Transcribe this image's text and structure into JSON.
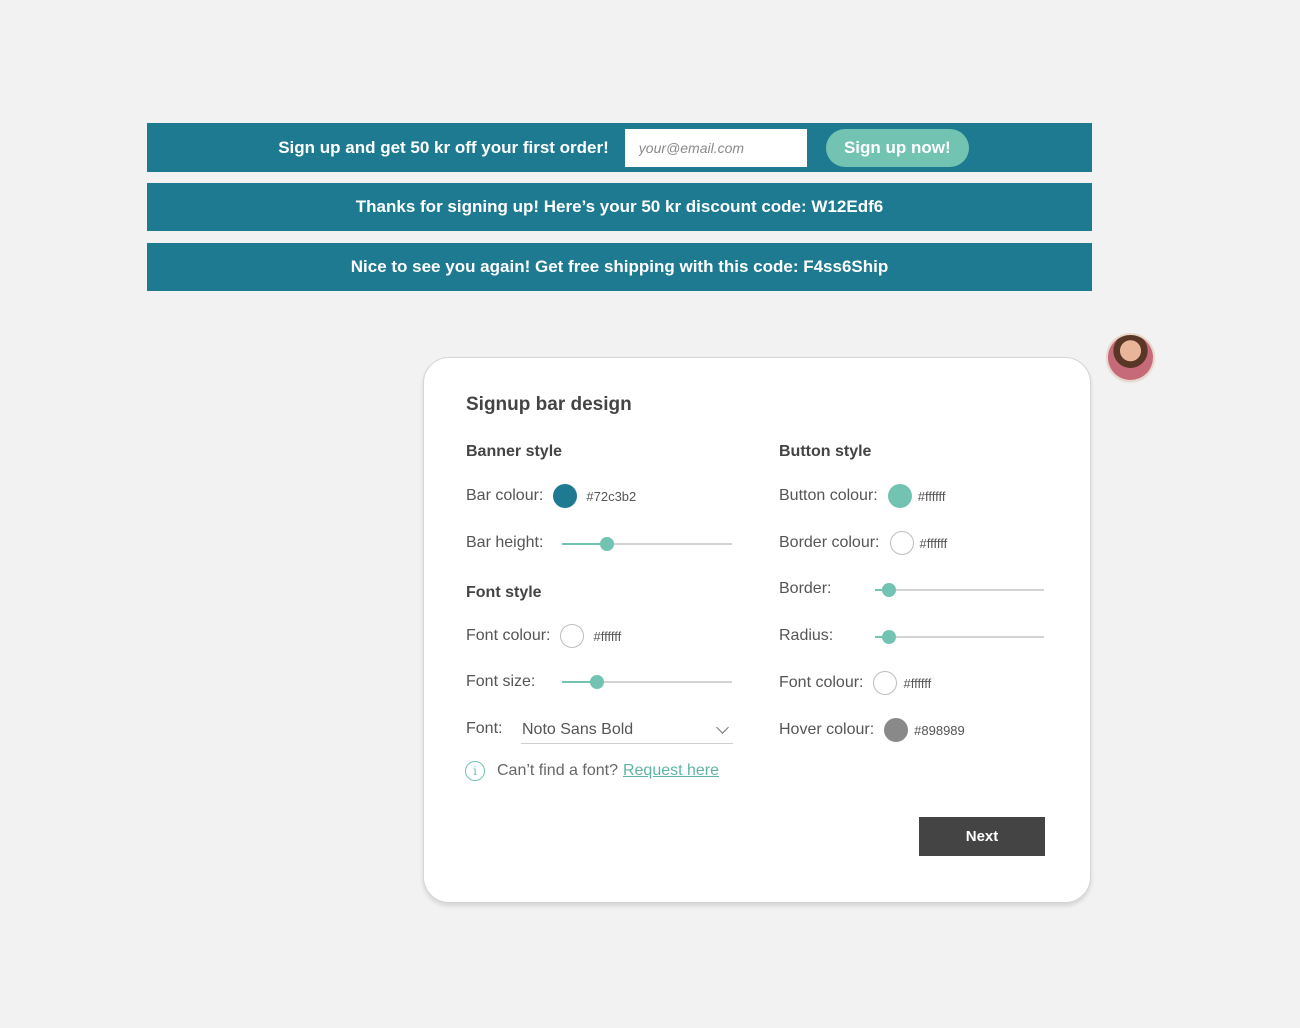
{
  "banners": {
    "signup": {
      "text": "Sign up and get 50 kr off your first order!",
      "email_placeholder": "your@email.com",
      "button_label": "Sign up now!"
    },
    "thanks": {
      "text": "Thanks for signing up! Here’s your 50 kr discount code: W12Edf6"
    },
    "returning": {
      "text": "Nice to see you again! Get free shipping with this code: F4ss6Ship"
    }
  },
  "card": {
    "title": "Signup bar design",
    "banner_style": {
      "title": "Banner style",
      "bar_colour_label": "Bar colour:",
      "bar_colour_value": "#72c3b2",
      "bar_colour_swatch": "#1d7a91",
      "bar_height_label": "Bar height:",
      "bar_height_level": 0.22
    },
    "font_style": {
      "title": "Font style",
      "font_colour_label": "Font colour:",
      "font_colour_value": "#ffffff",
      "font_size_label": "Font size:",
      "font_size_level": 0.15,
      "font_label": "Font:",
      "font_value": "Noto Sans Bold",
      "help_text": "Can’t find a font?",
      "help_link": "Request here"
    },
    "button_style": {
      "title": "Button style",
      "button_colour_label": "Button colour:",
      "button_colour_value": "#ffffff",
      "button_colour_swatch": "#72c3b2",
      "border_colour_label": "Border colour:",
      "border_colour_value": "#ffffff",
      "border_label": "Border:",
      "border_level": 0.0,
      "radius_label": "Radius:",
      "radius_level": 0.0,
      "font_colour_label": "Font colour:",
      "font_colour_value": "#ffffff",
      "hover_colour_label": "Hover colour:",
      "hover_colour_value": "#898989",
      "hover_colour_swatch": "#898989"
    },
    "next_label": "Next"
  }
}
